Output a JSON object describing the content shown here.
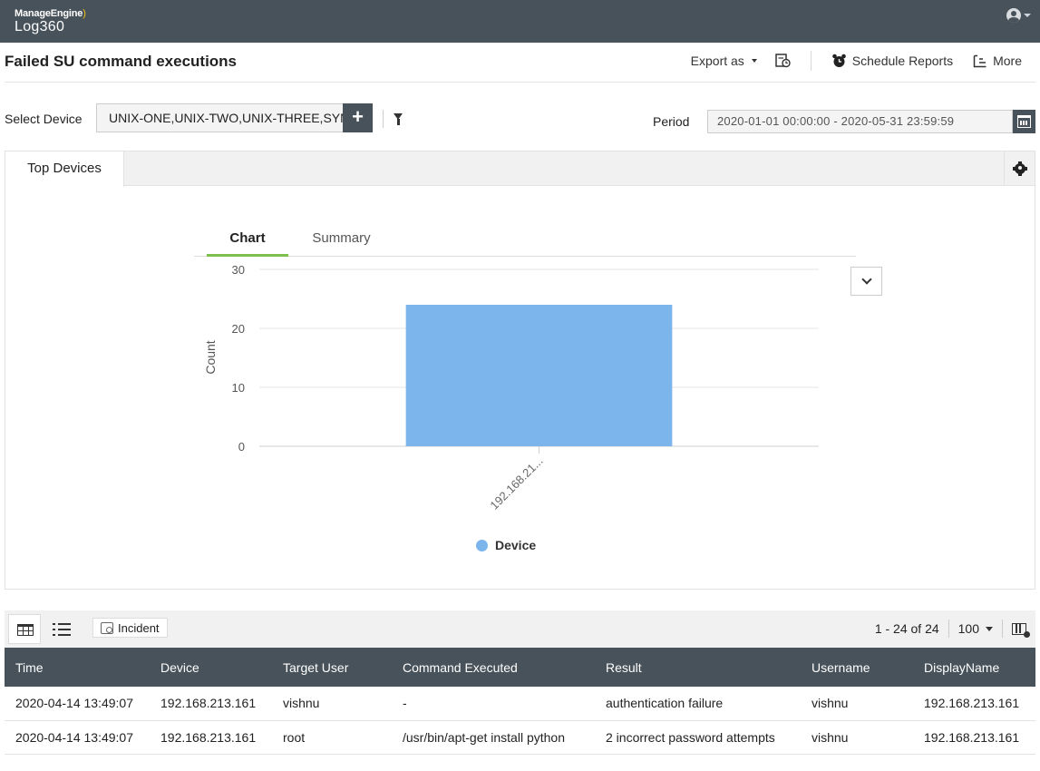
{
  "topbar": {
    "brand_small": "ManageEngine",
    "brand_big": "Log360"
  },
  "header": {
    "title": "Failed SU command executions",
    "export_label": "Export as",
    "schedule_label": "Schedule Reports",
    "more_label": "More"
  },
  "filters": {
    "device_label": "Select Device",
    "device_value": "UNIX-ONE,UNIX-TWO,UNIX-THREE,SYM",
    "add_label": "+",
    "period_label": "Period",
    "period_value": "2020-01-01 00:00:00 - 2020-05-31 23:59:59"
  },
  "panel": {
    "tab_label": "Top Devices",
    "subtabs": [
      "Chart",
      "Summary"
    ]
  },
  "chart_data": {
    "type": "bar",
    "categories": [
      "192.168.21..."
    ],
    "series": [
      {
        "name": "Device",
        "values": [
          24
        ],
        "color": "#7cb5ec"
      }
    ],
    "ylabel": "Count",
    "xlabel": "",
    "ylim": [
      0,
      30
    ],
    "yticks": [
      0,
      10,
      20,
      30
    ],
    "grid": true,
    "legend": "bottom-center"
  },
  "table": {
    "toolbar": {
      "incident_label": "Incident",
      "range": "1 - 24 of 24",
      "page_size": "100"
    },
    "columns": [
      "Time",
      "Device",
      "Target User",
      "Command Executed",
      "Result",
      "Username",
      "DisplayName"
    ],
    "rows": [
      [
        "2020-04-14 13:49:07",
        "192.168.213.161",
        "vishnu",
        "-",
        "authentication failure",
        "vishnu",
        "192.168.213.161"
      ],
      [
        "2020-04-14 13:49:07",
        "192.168.213.161",
        "root",
        "/usr/bin/apt-get install python",
        "2 incorrect password attempts",
        "vishnu",
        "192.168.213.161"
      ]
    ]
  }
}
